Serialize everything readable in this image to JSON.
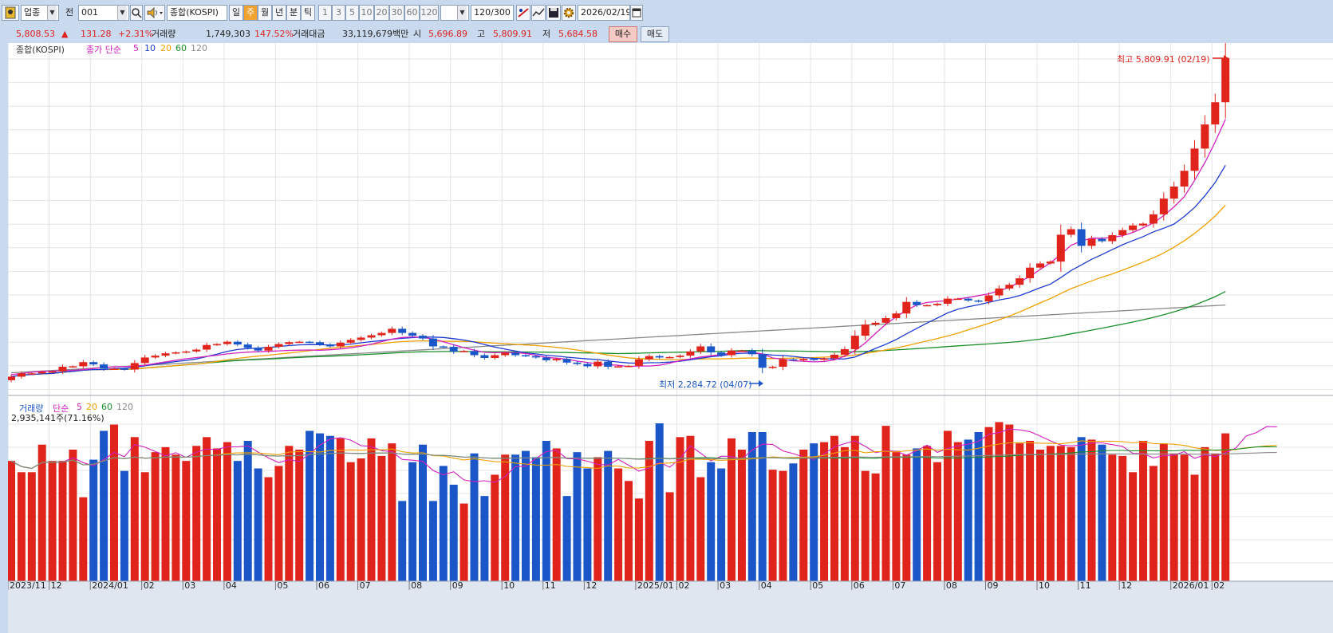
{
  "toolbar": {
    "market_combo": "업종",
    "period_combo_label": "전",
    "code_value": "001",
    "name_value": "종합(KOSPI)",
    "period_tabs": [
      {
        "label": "일",
        "selected": false
      },
      {
        "label": "주",
        "selected": true
      },
      {
        "label": "월",
        "selected": false
      },
      {
        "label": "년",
        "selected": false
      },
      {
        "label": "분",
        "selected": false
      },
      {
        "label": "틱",
        "selected": false
      }
    ],
    "interval_buttons": [
      "1",
      "3",
      "5",
      "10",
      "20",
      "30",
      "60",
      "120"
    ],
    "count_display": "120/300",
    "date_value": "2026/02/19"
  },
  "quote": {
    "price": "5,808.53",
    "change": "131.28",
    "change_rate": "+2.31%",
    "volume_label": "거래량",
    "volume_value": "1,749,303",
    "volume_ratio": "147.52%",
    "amount_label": "거래대금",
    "amount_value": "33,119,679백만",
    "open_label": "시",
    "open_value": "5,696.89",
    "high_label": "고",
    "high_value": "5,809.91",
    "low_label": "저",
    "low_value": "5,684.58",
    "buy_label": "매수",
    "sell_label": "매도"
  },
  "colors": {
    "up": "#e0241c",
    "down": "#1a56c8",
    "ma5": "#d21fbf",
    "ma10": "#1d3bd1",
    "ma20": "#f0a000",
    "ma60": "#1a8f2a",
    "ma120": "#888888"
  },
  "chart_data": {
    "type": "candlestick",
    "price_panel": {
      "title": "종합(KOSPI)",
      "legend_prefix": "종가 단순",
      "ma_periods": [
        "5",
        "10",
        "20",
        "60",
        "120"
      ],
      "high_marker": "최고 5,809.91 (02/19)",
      "low_marker": "최저 2,284.72 (04/07)",
      "ylim": [
        2200,
        5900
      ]
    },
    "volume_panel": {
      "title": "거래량",
      "legend_prefix": "단순",
      "ma_periods": [
        "5",
        "20",
        "60",
        "120"
      ],
      "last_value": "2,935,141주(71.16%)"
    },
    "x_ticks": [
      {
        "label": "2023/11",
        "index": 0
      },
      {
        "label": "12",
        "index": 4
      },
      {
        "label": "2024/01",
        "index": 8
      },
      {
        "label": "02",
        "index": 13
      },
      {
        "label": "03",
        "index": 17
      },
      {
        "label": "04",
        "index": 21
      },
      {
        "label": "05",
        "index": 26
      },
      {
        "label": "06",
        "index": 30
      },
      {
        "label": "07",
        "index": 34
      },
      {
        "label": "08",
        "index": 39
      },
      {
        "label": "09",
        "index": 43
      },
      {
        "label": "10",
        "index": 48
      },
      {
        "label": "11",
        "index": 52
      },
      {
        "label": "12",
        "index": 56
      },
      {
        "label": "2025/01",
        "index": 61
      },
      {
        "label": "02",
        "index": 65
      },
      {
        "label": "03",
        "index": 69
      },
      {
        "label": "04",
        "index": 73
      },
      {
        "label": "05",
        "index": 78
      },
      {
        "label": "06",
        "index": 82
      },
      {
        "label": "07",
        "index": 86
      },
      {
        "label": "08",
        "index": 91
      },
      {
        "label": "09",
        "index": 95
      },
      {
        "label": "10",
        "index": 100
      },
      {
        "label": "11",
        "index": 104
      },
      {
        "label": "12",
        "index": 108
      },
      {
        "label": "2026/01",
        "index": 113
      },
      {
        "label": "02",
        "index": 117
      }
    ],
    "close": [
      2368,
      2404,
      2404,
      2420,
      2425,
      2475,
      2480,
      2525,
      2500,
      2455,
      2455,
      2445,
      2515,
      2575,
      2595,
      2620,
      2630,
      2640,
      2660,
      2710,
      2720,
      2745,
      2715,
      2680,
      2650,
      2690,
      2720,
      2740,
      2745,
      2740,
      2715,
      2695,
      2735,
      2765,
      2790,
      2815,
      2840,
      2885,
      2840,
      2810,
      2780,
      2695,
      2690,
      2640,
      2645,
      2600,
      2570,
      2600,
      2625,
      2600,
      2590,
      2575,
      2545,
      2560,
      2520,
      2505,
      2480,
      2530,
      2475,
      2480,
      2485,
      2555,
      2590,
      2575,
      2580,
      2595,
      2640,
      2695,
      2630,
      2600,
      2650,
      2650,
      2610,
      2464,
      2475,
      2555,
      2545,
      2560,
      2550,
      2565,
      2605,
      2665,
      2810,
      2930,
      2950,
      3000,
      3050,
      3175,
      3140,
      3140,
      3155,
      3210,
      3210,
      3190,
      3180,
      3245,
      3320,
      3360,
      3430,
      3545,
      3590,
      3610,
      3900,
      3960,
      3780,
      3855,
      3830,
      3895,
      3950,
      4000,
      4020,
      4120,
      4290,
      4420,
      4590,
      4830,
      5090,
      5330,
      5808
    ],
    "volume": [
      960,
      870,
      870,
      1090,
      960,
      960,
      1050,
      670,
      970,
      1200,
      1250,
      880,
      1150,
      870,
      1030,
      1070,
      1010,
      960,
      1080,
      1150,
      1060,
      1110,
      960,
      1120,
      900,
      830,
      920,
      1080,
      1050,
      1200,
      1180,
      1160,
      1140,
      950,
      980,
      1140,
      1000,
      1100,
      640,
      950,
      1090,
      640,
      920,
      770,
      620,
      1020,
      680,
      850,
      1010,
      1010,
      1040,
      990,
      1120,
      1060,
      680,
      1030,
      900,
      990,
      1040,
      900,
      800,
      660,
      1120,
      1260,
      710,
      1150,
      1160,
      830,
      950,
      900,
      1140,
      1050,
      1190,
      1190,
      890,
      880,
      940,
      1050,
      1100,
      1110,
      1160,
      1070,
      1160,
      880,
      860,
      1240,
      1040,
      1010,
      1060,
      1080,
      950,
      1200,
      1110,
      1130,
      1190,
      1230,
      1270,
      1250,
      1100,
      1120,
      1050,
      1080,
      1080,
      1070,
      1150,
      1130,
      1090,
      1010,
      1000,
      870,
      1120,
      920,
      1100,
      1020,
      1010,
      850,
      1070,
      1020,
      1180,
      1190,
      1330,
      1210,
      1260,
      1170
    ],
    "ma5": [
      2391,
      2402,
      2417,
      2425,
      2427,
      2432,
      2437,
      2444,
      2456,
      2468,
      2475,
      2477,
      2481,
      2492,
      2510,
      2528,
      2545,
      2561,
      2574,
      2587,
      2599,
      2614,
      2625,
      2633,
      2637,
      2641,
      2647,
      2652,
      2654,
      2656,
      2653,
      2659,
      2667,
      2680,
      2698,
      2719,
      2746,
      2773,
      2791,
      2797,
      2792,
      2775,
      2745,
      2713,
      2681,
      2654,
      2631,
      2627,
      2630,
      2627,
      2618,
      2599,
      2577,
      2567,
      2557,
      2536,
      2522,
      2506,
      2498,
      2491,
      2476,
      2484,
      2483,
      2492,
      2514,
      2541,
      2560,
      2580,
      2593,
      2606,
      2625,
      2641,
      2631,
      2613,
      2570,
      2556,
      2539,
      2535,
      2528,
      2531,
      2549,
      2589,
      2650,
      2733,
      2836,
      2935,
      3014,
      3085,
      3141,
      3169,
      3180,
      3189,
      3208,
      3222,
      3243,
      3263,
      3295,
      3332,
      3389,
      3451,
      3525,
      3597,
      3688,
      3786,
      3832,
      3863,
      3862,
      3870,
      3890,
      3924,
      3973,
      4028,
      4107,
      4201,
      4312,
      4486,
      4678,
      4902,
      5146
    ]
  }
}
